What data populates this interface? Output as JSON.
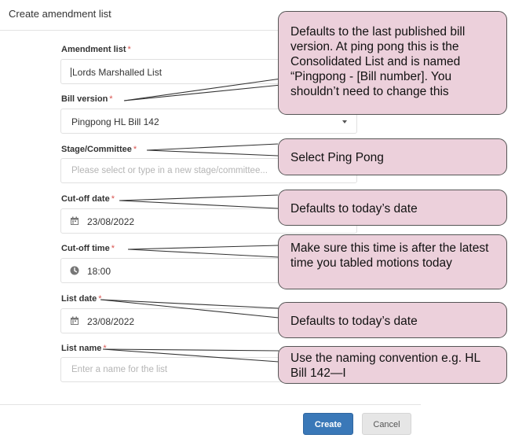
{
  "dialog": {
    "title": "Create amendment list"
  },
  "form": {
    "amendment_list": {
      "label": "Amendment list",
      "value": "Lords Marshalled List"
    },
    "bill_version": {
      "label": "Bill version",
      "value": "Pingpong HL Bill 142"
    },
    "stage": {
      "label": "Stage/Committee",
      "placeholder": "Please select or type in a new stage/committee..."
    },
    "cutoff_date": {
      "label": "Cut-off date",
      "value": "23/08/2022"
    },
    "cutoff_time": {
      "label": "Cut-off time",
      "value": "18:00"
    },
    "list_date": {
      "label": "List date",
      "value": "23/08/2022"
    },
    "list_name": {
      "label": "List name",
      "placeholder": "Enter a name for the list"
    },
    "required_mark": "*"
  },
  "buttons": {
    "create": "Create",
    "cancel": "Cancel"
  },
  "callouts": {
    "bill_version": "Defaults to the last published bill version.  At ping pong this is the Consolidated List and is named “Pingpong - [Bill number].  You shouldn’t need to change this",
    "stage": "Select Ping Pong",
    "cutoff_date": "Defaults to today’s date",
    "cutoff_time": "Make sure this time is after the latest time you tabled motions today",
    "list_date": "Defaults to today’s date",
    "list_name": "Use the naming convention e.g. HL Bill 142—I"
  },
  "colors": {
    "primary_button": "#3a78b8",
    "callout_fill": "#ecd0db",
    "required": "#d9534f"
  }
}
